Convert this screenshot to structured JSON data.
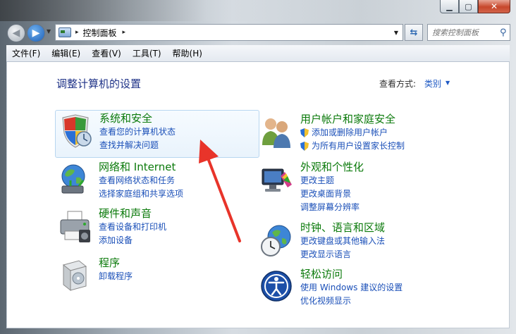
{
  "window": {
    "minimize_glyph": "▁",
    "maximize_glyph": "▢",
    "close_glyph": "✕"
  },
  "address": {
    "path": "控制面板",
    "separator": "▸"
  },
  "search": {
    "placeholder": "搜索控制面板"
  },
  "menu": [
    "文件(F)",
    "编辑(E)",
    "查看(V)",
    "工具(T)",
    "帮助(H)"
  ],
  "page_title": "调整计算机的设置",
  "view_by": {
    "label": "查看方式:",
    "value": "类别"
  },
  "categories": [
    {
      "id": "system-security",
      "title": "系统和安全",
      "links": [
        "查看您的计算机状态",
        "查找并解决问题"
      ],
      "icon": "system-security-shield-icon",
      "hovered": true
    },
    {
      "id": "network",
      "title": "网络和 Internet",
      "links": [
        "查看网络状态和任务",
        "选择家庭组和共享选项"
      ],
      "icon": "network-globe-icon"
    },
    {
      "id": "hardware",
      "title": "硬件和声音",
      "links": [
        "查看设备和打印机",
        "添加设备"
      ],
      "icon": "printer-icon"
    },
    {
      "id": "programs",
      "title": "程序",
      "links": [
        "卸载程序"
      ],
      "icon": "programs-box-icon"
    },
    {
      "id": "user-accounts",
      "title": "用户帐户和家庭安全",
      "links": [
        "添加或删除用户帐户",
        "为所有用户设置家长控制"
      ],
      "icon": "users-icon",
      "link_icon": "uac-shield-icon"
    },
    {
      "id": "appearance",
      "title": "外观和个性化",
      "links": [
        "更改主题",
        "更改桌面背景",
        "调整屏幕分辨率"
      ],
      "icon": "monitor-palette-icon"
    },
    {
      "id": "clock-region",
      "title": "时钟、语言和区域",
      "links": [
        "更改键盘或其他输入法",
        "更改显示语言"
      ],
      "icon": "clock-globe-icon"
    },
    {
      "id": "ease-of-access",
      "title": "轻松访问",
      "links": [
        "使用 Windows 建议的设置",
        "优化视频显示"
      ],
      "icon": "ease-of-access-icon"
    }
  ],
  "colors": {
    "category_title": "#0b7a0b",
    "link": "#1a4fb8",
    "page_title": "#1e3287",
    "annotation_arrow": "#e8342a"
  }
}
